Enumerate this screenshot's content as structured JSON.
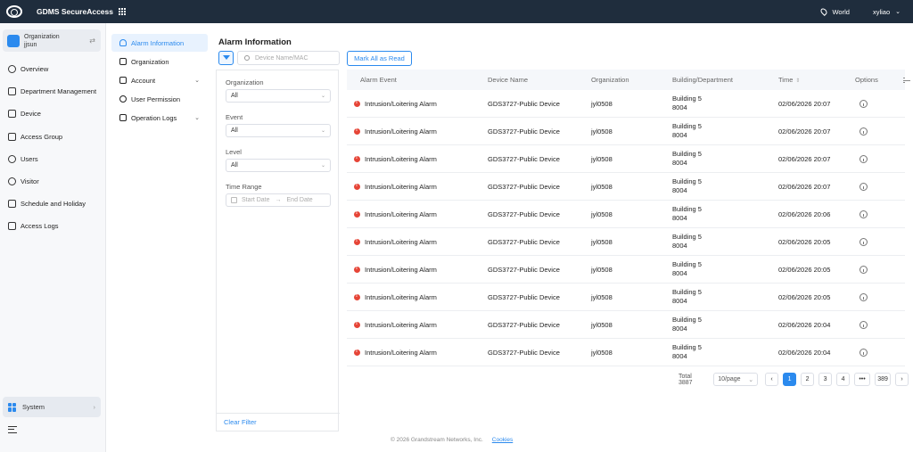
{
  "topbar": {
    "app_title": "GDMS SecureAccess",
    "region": "World",
    "user": "xyliao"
  },
  "org": {
    "label": "Organization",
    "name": "jjsun"
  },
  "leftnav": {
    "items": [
      {
        "label": "Overview",
        "icon": "overview-icon"
      },
      {
        "label": "Department Management",
        "icon": "department-icon"
      },
      {
        "label": "Device",
        "icon": "device-icon"
      },
      {
        "label": "Access Group",
        "icon": "access-group-icon"
      },
      {
        "label": "Users",
        "icon": "users-icon"
      },
      {
        "label": "Visitor",
        "icon": "visitor-icon"
      },
      {
        "label": "Schedule and Holiday",
        "icon": "calendar-icon"
      },
      {
        "label": "Access Logs",
        "icon": "logs-icon"
      }
    ],
    "system": "System"
  },
  "subnav": {
    "items": [
      {
        "label": "Alarm Information"
      },
      {
        "label": "Organization"
      },
      {
        "label": "Account"
      },
      {
        "label": "User Permission"
      },
      {
        "label": "Operation Logs"
      }
    ]
  },
  "page": {
    "title": "Alarm Information",
    "search_placeholder": "Device Name/MAC",
    "mark_all": "Mark All as Read"
  },
  "filters": {
    "organization_label": "Organization",
    "organization_value": "All",
    "event_label": "Event",
    "event_value": "All",
    "level_label": "Level",
    "level_value": "All",
    "time_label": "Time Range",
    "start_placeholder": "Start Date",
    "end_placeholder": "End Date",
    "clear": "Clear Filter"
  },
  "table": {
    "headers": [
      "Alarm Event",
      "Device Name",
      "Organization",
      "Building/Department",
      "Time",
      "Options"
    ],
    "rows": [
      {
        "event": "Intrusion/Loitering Alarm",
        "device": "GDS3727-Public Device",
        "org": "jyl0508",
        "building": "Building 5",
        "dept": "8004",
        "time": "02/06/2026 20:07"
      },
      {
        "event": "Intrusion/Loitering Alarm",
        "device": "GDS3727-Public Device",
        "org": "jyl0508",
        "building": "Building 5",
        "dept": "8004",
        "time": "02/06/2026 20:07"
      },
      {
        "event": "Intrusion/Loitering Alarm",
        "device": "GDS3727-Public Device",
        "org": "jyl0508",
        "building": "Building 5",
        "dept": "8004",
        "time": "02/06/2026 20:07"
      },
      {
        "event": "Intrusion/Loitering Alarm",
        "device": "GDS3727-Public Device",
        "org": "jyl0508",
        "building": "Building 5",
        "dept": "8004",
        "time": "02/06/2026 20:07"
      },
      {
        "event": "Intrusion/Loitering Alarm",
        "device": "GDS3727-Public Device",
        "org": "jyl0508",
        "building": "Building 5",
        "dept": "8004",
        "time": "02/06/2026 20:06"
      },
      {
        "event": "Intrusion/Loitering Alarm",
        "device": "GDS3727-Public Device",
        "org": "jyl0508",
        "building": "Building 5",
        "dept": "8004",
        "time": "02/06/2026 20:05"
      },
      {
        "event": "Intrusion/Loitering Alarm",
        "device": "GDS3727-Public Device",
        "org": "jyl0508",
        "building": "Building 5",
        "dept": "8004",
        "time": "02/06/2026 20:05"
      },
      {
        "event": "Intrusion/Loitering Alarm",
        "device": "GDS3727-Public Device",
        "org": "jyl0508",
        "building": "Building 5",
        "dept": "8004",
        "time": "02/06/2026 20:05"
      },
      {
        "event": "Intrusion/Loitering Alarm",
        "device": "GDS3727-Public Device",
        "org": "jyl0508",
        "building": "Building 5",
        "dept": "8004",
        "time": "02/06/2026 20:04"
      },
      {
        "event": "Intrusion/Loitering Alarm",
        "device": "GDS3727-Public Device",
        "org": "jyl0508",
        "building": "Building 5",
        "dept": "8004",
        "time": "02/06/2026 20:04"
      }
    ]
  },
  "pager": {
    "total": "Total 3887",
    "page_size": "10/page",
    "pages": [
      "1",
      "2",
      "3",
      "4",
      "•••",
      "389"
    ],
    "current": "1"
  },
  "footer": {
    "copyright": "© 2026 Grandstream Networks, Inc.",
    "cookies": "Cookies"
  },
  "colors": {
    "accent": "#2b8aee",
    "topbar": "#1f2d3d",
    "alarm": "#e64537"
  }
}
